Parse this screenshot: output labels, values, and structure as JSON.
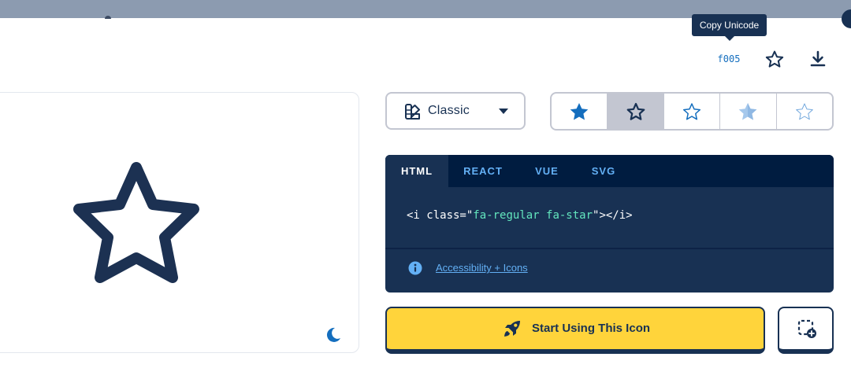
{
  "tooltip": {
    "text": "Copy Unicode"
  },
  "header": {
    "unicode": "f005"
  },
  "icon": {
    "name": "star",
    "icon_name": "star-icon"
  },
  "style_select": {
    "selected": "Classic",
    "icon_name": "palette-icon"
  },
  "variants": [
    {
      "label": "solid",
      "icon_name": "star-solid-icon",
      "active": false
    },
    {
      "label": "regular",
      "icon_name": "star-regular-icon",
      "active": true
    },
    {
      "label": "light",
      "icon_name": "star-light-icon",
      "active": false
    },
    {
      "label": "duotone",
      "icon_name": "star-duotone-icon",
      "active": false
    },
    {
      "label": "thin",
      "icon_name": "star-thin-icon",
      "active": false
    }
  ],
  "code": {
    "tabs": [
      "HTML",
      "REACT",
      "VUE",
      "SVG"
    ],
    "active_tab": "HTML",
    "open": "<i class=\"",
    "class_value": "fa-regular fa-star",
    "close": "\"></i>",
    "link": "Accessibility + Icons"
  },
  "actions": {
    "start_label": "Start Using This Icon",
    "kit_icon": "add-to-kit-icon"
  },
  "colors": {
    "navy": "#183153",
    "blue": "#146ebe",
    "yellow": "#ffd43b",
    "mint": "#63e6be"
  }
}
